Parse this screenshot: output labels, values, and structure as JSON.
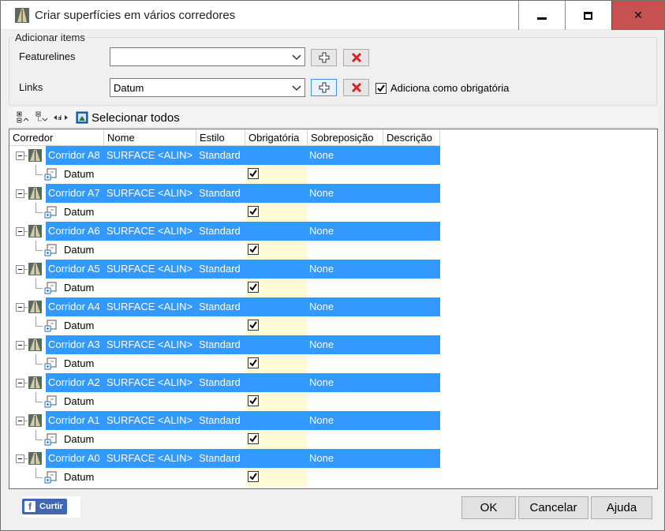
{
  "window": {
    "title": "Criar superfícies em vários corredores"
  },
  "add_items": {
    "legend": "Adicionar items",
    "featurelines_label": "Featurelines",
    "featurelines_value": "",
    "links_label": "Links",
    "links_value": "Datum",
    "mandatory_label": "Adiciona como obrigatória",
    "mandatory_checked": true
  },
  "toolbar": {
    "select_all_label": "Selecionar todos"
  },
  "grid": {
    "columns": [
      "Corredor",
      "Nome",
      "Estilo",
      "Obrigatória",
      "Sobreposição",
      "Descrição"
    ],
    "rows": [
      {
        "corridor": "Corridor A8",
        "name": "SURFACE <ALIN>",
        "style": "Standard",
        "overlap": "None",
        "child": "Datum"
      },
      {
        "corridor": "Corridor A7",
        "name": "SURFACE <ALIN>",
        "style": "Standard",
        "overlap": "None",
        "child": "Datum"
      },
      {
        "corridor": "Corridor A6",
        "name": "SURFACE <ALIN>",
        "style": "Standard",
        "overlap": "None",
        "child": "Datum"
      },
      {
        "corridor": "Corridor A5",
        "name": "SURFACE <ALIN>",
        "style": "Standard",
        "overlap": "None",
        "child": "Datum"
      },
      {
        "corridor": "Corridor A4",
        "name": "SURFACE <ALIN>",
        "style": "Standard",
        "overlap": "None",
        "child": "Datum"
      },
      {
        "corridor": "Corridor A3",
        "name": "SURFACE <ALIN>",
        "style": "Standard",
        "overlap": "None",
        "child": "Datum"
      },
      {
        "corridor": "Corridor A2",
        "name": "SURFACE <ALIN>",
        "style": "Standard",
        "overlap": "None",
        "child": "Datum"
      },
      {
        "corridor": "Corridor A1",
        "name": "SURFACE <ALIN>",
        "style": "Standard",
        "overlap": "None",
        "child": "Datum"
      },
      {
        "corridor": "Corridor A0",
        "name": "SURFACE <ALIN>",
        "style": "Standard",
        "overlap": "None",
        "child": "Datum"
      }
    ]
  },
  "footer": {
    "like_label": "Curtir",
    "ok_label": "OK",
    "cancel_label": "Cancelar",
    "help_label": "Ajuda"
  },
  "colors": {
    "selection": "#3399ff",
    "close_button": "#c75050",
    "mandatory_cell": "#fffbd6",
    "facebook": "#4267b2"
  }
}
